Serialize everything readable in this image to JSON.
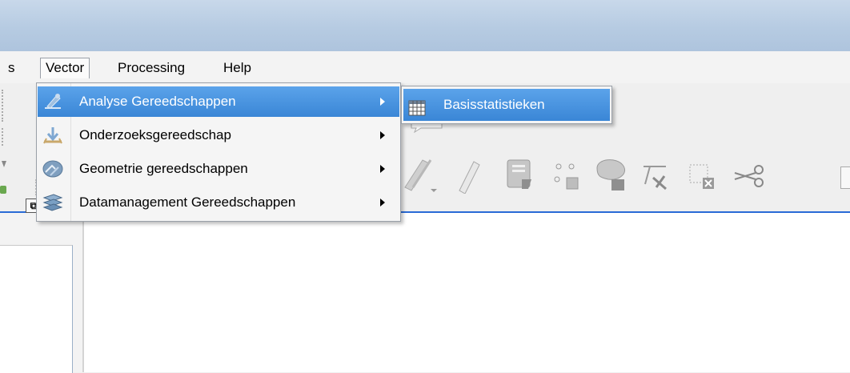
{
  "menubar": {
    "items": [
      {
        "label": "s"
      },
      {
        "label": "Vector"
      },
      {
        "label": "Processing"
      },
      {
        "label": "Help"
      }
    ]
  },
  "vector_menu": {
    "items": [
      {
        "label": "Analyse Gereedschappen",
        "icon": "analysis-tools-icon",
        "active": true,
        "has_submenu": true
      },
      {
        "label": "Onderzoeksgereedschap",
        "icon": "research-tools-icon",
        "active": false,
        "has_submenu": true
      },
      {
        "label": "Geometrie gereedschappen",
        "icon": "geometry-tools-icon",
        "active": false,
        "has_submenu": true
      },
      {
        "label": "Datamanagement Gereedschappen",
        "icon": "data-management-icon",
        "active": false,
        "has_submenu": true
      }
    ]
  },
  "submenu": {
    "items": [
      {
        "label": "Basisstatistieken",
        "icon": "basic-statistics-icon"
      }
    ]
  },
  "colors": {
    "highlight": "#3a86d6",
    "titlebar": "#b6cbe2"
  }
}
